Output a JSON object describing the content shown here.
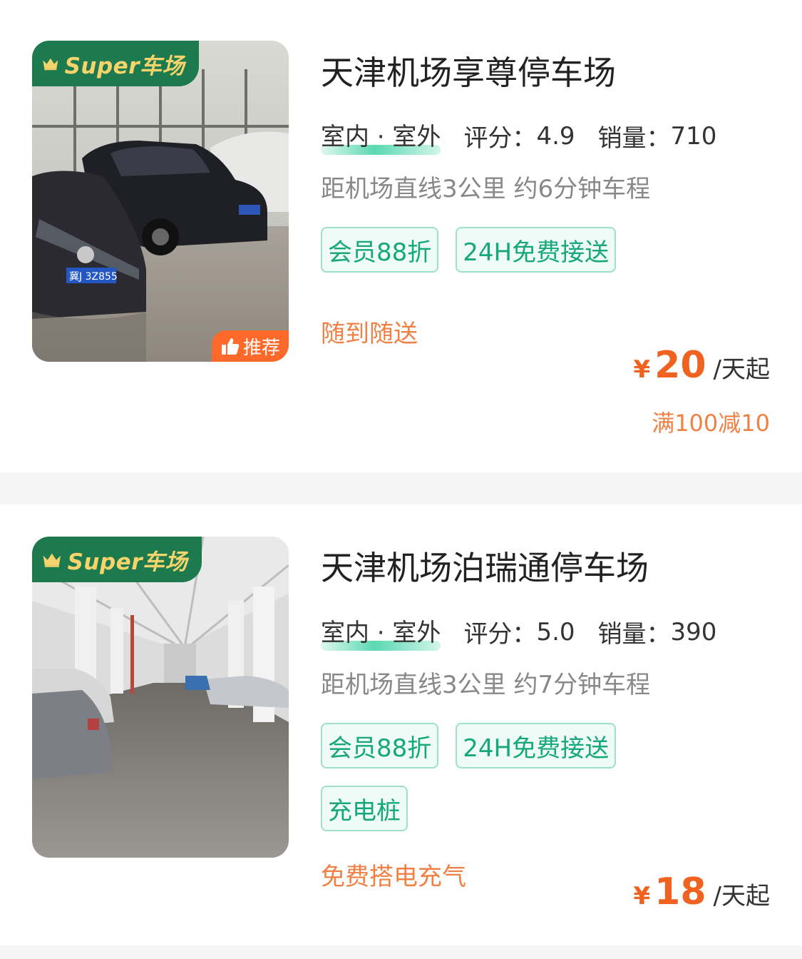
{
  "listings": [
    {
      "badge": "Super车场",
      "recommend": "推荐",
      "title": "天津机场享尊停车场",
      "environment": "室内 · 室外",
      "rating_label": "评分：",
      "rating": "4.9",
      "sales_label": "销量：",
      "sales": "710",
      "distance": "距机场直线3公里 约6分钟车程",
      "tags": [
        "会员88折",
        "24H免费接送"
      ],
      "perk": "随到随送",
      "currency": "¥",
      "price": "20",
      "price_unit": "/天起",
      "discount": "满100减10"
    },
    {
      "badge": "Super车场",
      "title": "天津机场泊瑞通停车场",
      "environment": "室内 · 室外",
      "rating_label": "评分：",
      "rating": "5.0",
      "sales_label": "销量：",
      "sales": "390",
      "distance": "距机场直线3公里 约7分钟车程",
      "tags": [
        "会员88折",
        "24H免费接送",
        "充电桩"
      ],
      "perk": "免费搭电充气",
      "currency": "¥",
      "price": "18",
      "price_unit": "/天起"
    }
  ],
  "colors": {
    "badge_bg": "#1d7a4e",
    "badge_text": "#f6d36b",
    "tag_text": "#16a87a",
    "price": "#f0621f",
    "perk": "#f08043",
    "recommend_bg": "#ff6a2b"
  },
  "icons": [
    "crown-icon",
    "thumbs-up-icon"
  ]
}
